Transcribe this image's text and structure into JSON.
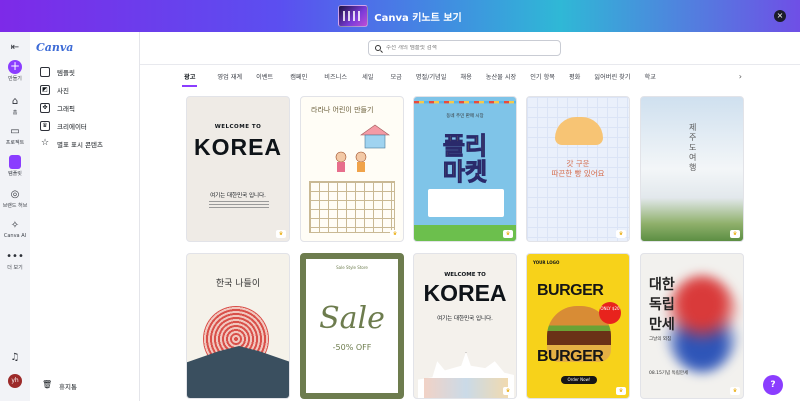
{
  "banner": {
    "title": "Canva 키노트 보기",
    "close_icon": "close-icon"
  },
  "rail": {
    "items": [
      {
        "label": "만들기",
        "icon": "plus-icon"
      },
      {
        "label": "홈",
        "icon": "home-icon"
      },
      {
        "label": "프로젝트",
        "icon": "folder-icon"
      },
      {
        "label": "템플릿",
        "icon": "template-icon"
      },
      {
        "label": "브랜드 허브",
        "icon": "brand-icon"
      },
      {
        "label": "Canva AI",
        "icon": "ai-icon"
      },
      {
        "label": "더 보기",
        "icon": "more-icon"
      }
    ],
    "avatar": "yh"
  },
  "panel": {
    "logo": "Canva",
    "menu": [
      {
        "label": "템플릿",
        "icon": "template-icon"
      },
      {
        "label": "사진",
        "icon": "photo-icon"
      },
      {
        "label": "그래픽",
        "icon": "graphic-icon"
      },
      {
        "label": "크리에이터",
        "icon": "creator-icon"
      },
      {
        "label": "별표 표시 콘텐츠",
        "icon": "star-icon"
      }
    ],
    "trash": "휴지통"
  },
  "search": {
    "placeholder": "수천 개의 템플릿 검색"
  },
  "tabs": [
    "광고",
    "영업 재계",
    "이벤트",
    "캠페인",
    "비즈니스",
    "세일",
    "모금",
    "명절/기념일",
    "채용",
    "농산물 시장",
    "인기 항목",
    "평화",
    "잃어버린",
    "잃어버린 찾기",
    "학교"
  ],
  "cards": {
    "korea1": {
      "welcome": "WELCOME TO",
      "title": "KOREA",
      "sub": "여기는 대한민국 입니다."
    },
    "drawing": {
      "title": "라라나 어린이 만들기"
    },
    "market": {
      "head": "동네 주민 판매 시장",
      "title": "플리\n마켓"
    },
    "bread": {
      "text": "갓 구운\n따끈한 빵 있어요"
    },
    "jeju": {
      "text": "제주도 여행"
    },
    "trip": {
      "title": "한국 나들이"
    },
    "sale": {
      "head": "Sale Style Store",
      "title": "Sale",
      "off": "-50% OFF"
    },
    "korea2": {
      "welcome": "WELCOME TO",
      "title": "KOREA",
      "sub": "여기는 대한민국 입니다."
    },
    "burger": {
      "logo": "YOUR LOGO",
      "word": "BURGER",
      "only": "ONLY $20",
      "order": "Order Now!"
    },
    "independence": {
      "line1": "대한",
      "line2": "독립",
      "line3": "만세",
      "sub": "그날의 외침",
      "date": "08.15기념 독립만세"
    }
  },
  "help": "?"
}
